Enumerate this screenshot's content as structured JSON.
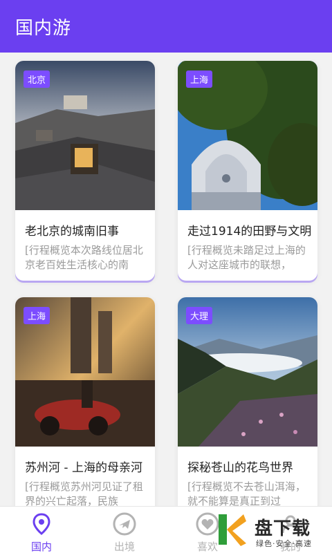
{
  "appbar": {
    "title": "国内游"
  },
  "cards": [
    {
      "tag": "北京",
      "title": "老北京的城南旧事",
      "desc": "[行程概览本次路线位居北京老百姓生活核心的南"
    },
    {
      "tag": "上海",
      "title": "走过1914的田野与文明",
      "desc": "[行程概览未踏足过上海的人对这座城市的联想，"
    },
    {
      "tag": "上海",
      "title": "苏州河 - 上海的母亲河",
      "desc": "[行程概览苏州河见证了租界的兴亡起落，民族"
    },
    {
      "tag": "大理",
      "title": "探秘苍山的花鸟世界",
      "desc": "[行程概览不去苍山洱海，就不能算是真正到过"
    }
  ],
  "tabs": [
    {
      "label": "国内",
      "icon": "location-pin-icon",
      "active": true
    },
    {
      "label": "出境",
      "icon": "airplane-icon",
      "active": false
    },
    {
      "label": "喜欢",
      "icon": "heart-icon",
      "active": false
    },
    {
      "label": "我的",
      "icon": "user-icon",
      "active": false
    }
  ],
  "watermark": {
    "brand": "盘下载",
    "tagline": "绿色·安全·高速"
  },
  "colors": {
    "primary": "#6b3ff0",
    "tag": "#7c4dff",
    "inactive": "#b3b3b3"
  }
}
